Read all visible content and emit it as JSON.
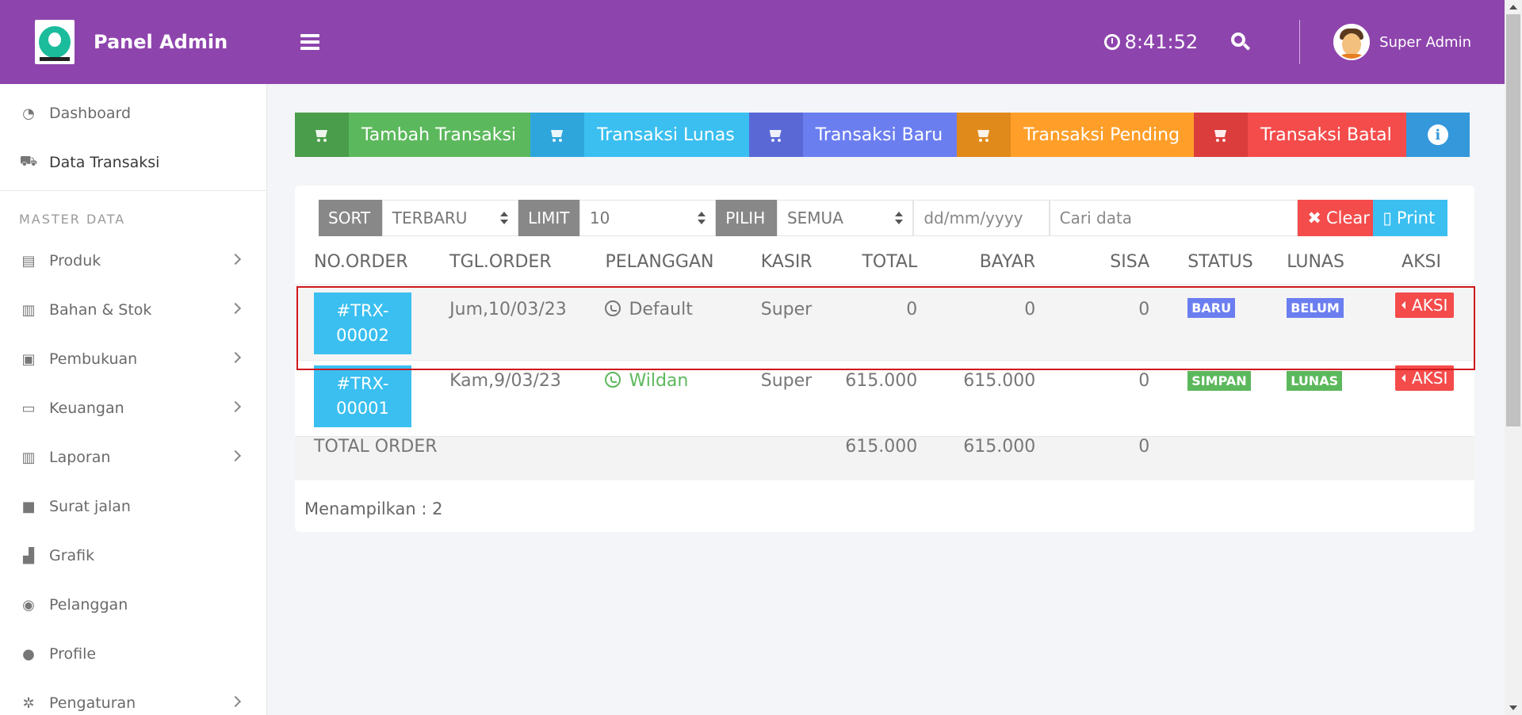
{
  "header": {
    "brand_title": "Panel Admin",
    "clock": "8:41:52",
    "user_name": "Super Admin",
    "colors": {
      "header_bg": "#8e44ad"
    }
  },
  "sidebar": {
    "items_top": [
      {
        "label": "Dashboard",
        "icon": "dashboard-icon"
      },
      {
        "label": "Data Transaksi",
        "icon": "cart-icon",
        "active": true
      }
    ],
    "section_heading": "MASTER DATA",
    "items": [
      {
        "label": "Produk",
        "icon": "file-icon",
        "has_chevron": true
      },
      {
        "label": "Bahan & Stok",
        "icon": "book-icon",
        "has_chevron": true
      },
      {
        "label": "Pembukuan",
        "icon": "ledger-icon",
        "has_chevron": true
      },
      {
        "label": "Keuangan",
        "icon": "credit-card-icon",
        "has_chevron": true
      },
      {
        "label": "Laporan",
        "icon": "book-icon",
        "has_chevron": true
      },
      {
        "label": "Surat jalan",
        "icon": "note-icon",
        "has_chevron": false
      },
      {
        "label": "Grafik",
        "icon": "bar-chart-icon",
        "has_chevron": false
      },
      {
        "label": "Pelanggan",
        "icon": "user-circle-icon",
        "has_chevron": false
      },
      {
        "label": "Profile",
        "icon": "user-icon",
        "has_chevron": false
      },
      {
        "label": "Pengaturan",
        "icon": "gear-icon",
        "has_chevron": true
      }
    ]
  },
  "toolbar": {
    "buttons": [
      {
        "label": "Tambah Transaksi",
        "icon_bg": "#4a9d4a",
        "bg": "#5cb85c"
      },
      {
        "label": "Transaksi Lunas",
        "icon_bg": "#2ea6dc",
        "bg": "#3abff0"
      },
      {
        "label": "Transaksi Baru",
        "icon_bg": "#5a68d6",
        "bg": "#6b7ef0"
      },
      {
        "label": "Transaksi Pending",
        "icon_bg": "#e08a1c",
        "bg": "#ff9f2a"
      },
      {
        "label": "Transaksi Batal",
        "icon_bg": "#db3c3c",
        "bg": "#f44b4b"
      }
    ],
    "info_icon": "info-icon",
    "info_bg": "#3498db"
  },
  "filters": {
    "sort_tag": "SORT",
    "sort_value": "TERBARU",
    "limit_tag": "LIMIT",
    "limit_value": "10",
    "pilih_tag": "PILIH",
    "pilih_value": "SEMUA",
    "date_placeholder": "dd/mm/yyyy",
    "search_placeholder": "Cari data",
    "clear_label": "Clear",
    "print_label": "Print"
  },
  "table": {
    "headers": [
      "NO.ORDER",
      "TGL.ORDER",
      "PELANGGAN",
      "KASIR",
      "TOTAL",
      "BAYAR",
      "SISA",
      "STATUS",
      "LUNAS",
      "AKSI"
    ],
    "rows": [
      {
        "order_line1": "#TRX-",
        "order_line2": "00002",
        "date": "Jum,10/03/23",
        "customer": "Default",
        "cashier": "Super",
        "total": "0",
        "paid": "0",
        "remaining": "0",
        "status": "BARU",
        "status_color": "#6b7ef0",
        "lunas": "BELUM",
        "lunas_color": "#6b7ef0",
        "action": "AKSI",
        "customer_color": "#777"
      },
      {
        "order_line1": "#TRX-",
        "order_line2": "00001",
        "date": "Kam,9/03/23",
        "customer": "Wildan",
        "cashier": "Super",
        "total": "615.000",
        "paid": "615.000",
        "remaining": "0",
        "status": "SIMPAN",
        "status_color": "#5cb85c",
        "lunas": "LUNAS",
        "lunas_color": "#5cb85c",
        "action": "AKSI",
        "customer_color": "#5cb85c"
      }
    ],
    "total_label": "TOTAL ORDER",
    "total_total": "615.000",
    "total_paid": "615.000",
    "total_remaining": "0"
  },
  "footer": {
    "showing": "Menampilkan : 2"
  }
}
